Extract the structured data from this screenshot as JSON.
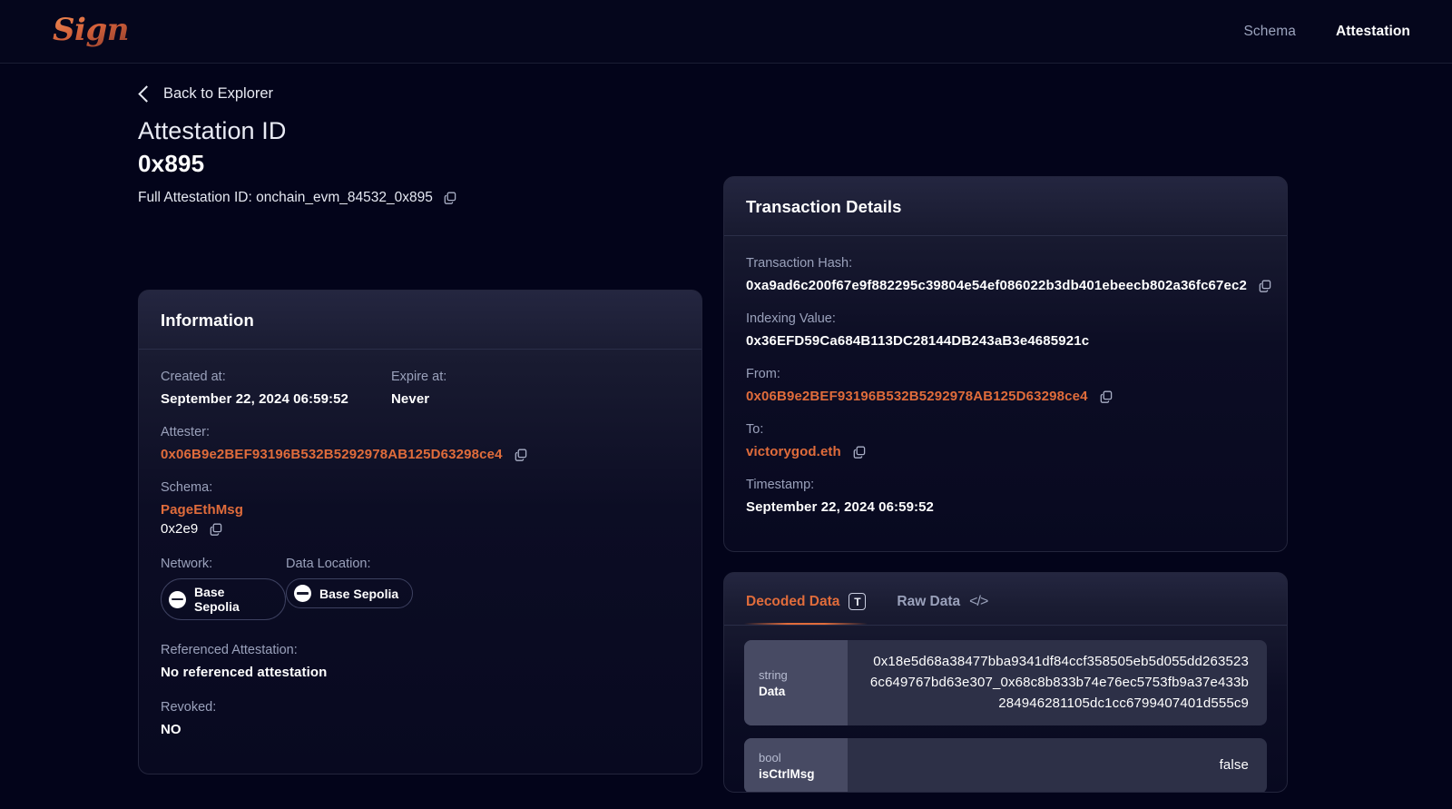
{
  "nav": {
    "brand": "Sign",
    "links": [
      {
        "label": "Schema",
        "active": false
      },
      {
        "label": "Attestation",
        "active": true
      }
    ]
  },
  "back": {
    "label": "Back to Explorer",
    "icon": "chevron-left-icon"
  },
  "header": {
    "attestation_label": "Attestation ID",
    "attestation_id": "0x895",
    "full_id_text": "Full Attestation ID: onchain_evm_84532_0x895",
    "copy_icon": "copy-icon"
  },
  "information": {
    "title": "Information",
    "created_at_label": "Created at:",
    "created_at_value": "September 22, 2024 06:59:52",
    "expire_at_label": "Expire at:",
    "expire_at_value": "Never",
    "attester_label": "Attester:",
    "attester_value": "0x06B9e2BEF93196B532B5292978AB125D63298ce4",
    "schema_label": "Schema:",
    "schema_name": "PageEthMsg",
    "schema_id": "0x2e9",
    "network_label": "Network:",
    "network_value": "Base Sepolia",
    "data_location_label": "Data Location:",
    "data_location_value": "Base Sepolia",
    "referenced_label": "Referenced Attestation:",
    "referenced_value": "No referenced attestation",
    "revoked_label": "Revoked:",
    "revoked_value": "NO"
  },
  "transaction": {
    "title": "Transaction Details",
    "hash_label": "Transaction Hash:",
    "hash_value": "0xa9ad6c200f67e9f882295c39804e54ef086022b3db401ebeecb802a36fc67ec2",
    "indexing_label": "Indexing Value:",
    "indexing_value": "0x36EFD59Ca684B113DC28144DB243aB3e4685921c",
    "from_label": "From:",
    "from_value": "0x06B9e2BEF93196B532B5292978AB125D63298ce4",
    "to_label": "To:",
    "to_value": "victorygod.eth",
    "timestamp_label": "Timestamp:",
    "timestamp_value": "September 22, 2024 06:59:52"
  },
  "data_panel": {
    "tabs": [
      {
        "label": "Decoded Data",
        "icon": "text-box-icon",
        "glyph": "T",
        "active": true
      },
      {
        "label": "Raw Data",
        "icon": "code-brackets-icon",
        "glyph": "</>",
        "active": false
      }
    ],
    "rows": [
      {
        "type": "string",
        "name": "Data",
        "value": "0x18e5d68a38477bba9341df84ccf358505eb5d055dd2635236c649767bd63e307_0x68c8b833b74e76ec5753fb9a37e433b284946281105dc1cc6799407401d555c9"
      },
      {
        "type": "bool",
        "name": "isCtrlMsg",
        "value": "false"
      }
    ]
  },
  "colors": {
    "page_bg": "#03041a",
    "accent": "#e06c3b",
    "card_top": "#242640",
    "card_bottom": "#080920",
    "muted_text": "#9aa1bb",
    "key_cell": "#474a63",
    "value_cell": "#2d3047"
  }
}
